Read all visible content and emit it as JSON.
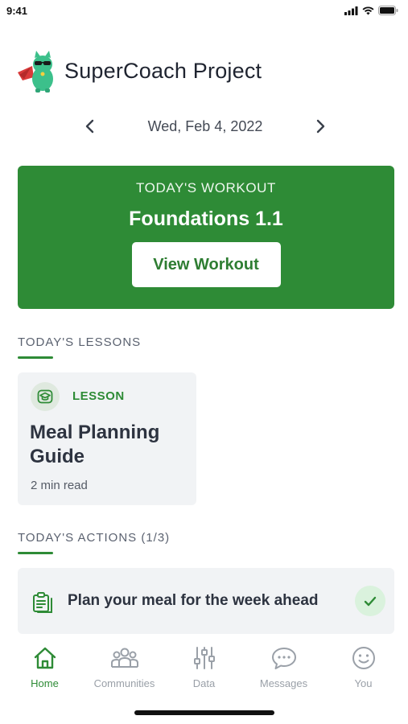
{
  "status_bar": {
    "time": "9:41"
  },
  "app": {
    "title": "SuperCoach Project"
  },
  "date_nav": {
    "date": "Wed, Feb 4, 2022"
  },
  "workout": {
    "kicker": "TODAY'S WORKOUT",
    "title": "Foundations 1.1",
    "button_label": "View Workout"
  },
  "lessons": {
    "heading": "TODAY'S LESSONS",
    "items": [
      {
        "kind": "LESSON",
        "title": "Meal Planning Guide",
        "meta": "2 min read",
        "icon": "graduation-cap-icon"
      }
    ]
  },
  "actions": {
    "heading": "TODAY'S ACTIONS (1/3)",
    "items": [
      {
        "label": "Plan your meal for the week ahead",
        "done": true,
        "icon": "clipboard-icon"
      }
    ]
  },
  "tabs": [
    {
      "label": "Home",
      "icon": "home-icon",
      "active": true
    },
    {
      "label": "Communities",
      "icon": "people-icon",
      "active": false
    },
    {
      "label": "Data",
      "icon": "sliders-icon",
      "active": false
    },
    {
      "label": "Messages",
      "icon": "chat-icon",
      "active": false
    },
    {
      "label": "You",
      "icon": "smiley-icon",
      "active": false
    }
  ],
  "colors": {
    "brand_green": "#2e8b36",
    "card_gray": "#f1f3f5",
    "inactive_gray": "#9aa0a8"
  }
}
